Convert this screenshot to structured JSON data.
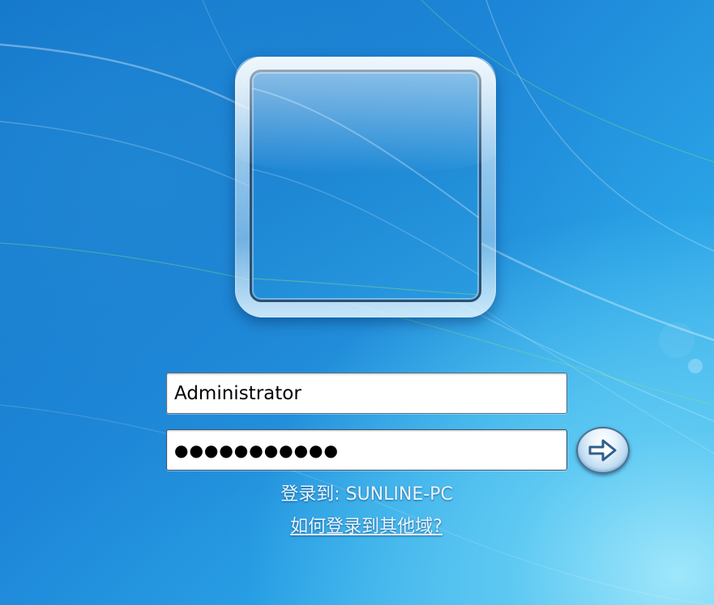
{
  "login": {
    "username": "Administrator",
    "password_masked": "●●●●●●●●●●●",
    "domain_prefix": "登录到:",
    "computer_name": "SUNLINE-PC",
    "help_link": "如何登录到其他域?"
  },
  "icons": {
    "avatar": "user-picture-frame",
    "submit": "arrow-right-icon"
  },
  "colors": {
    "background": "#1d86d8",
    "text": "#eaf5ff"
  }
}
